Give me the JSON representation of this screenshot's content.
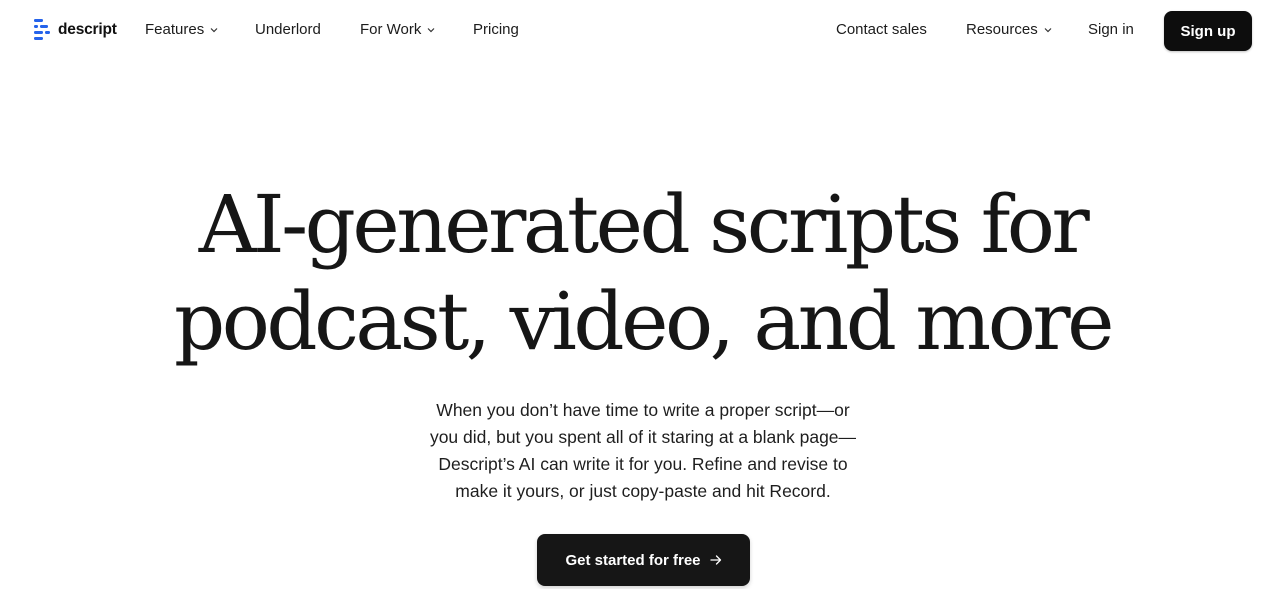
{
  "brand": {
    "name": "descript",
    "logo_icon": "descript-logo-icon",
    "accent_color": "#2563eb"
  },
  "nav": {
    "left": [
      {
        "label": "Features",
        "dropdown": true
      },
      {
        "label": "Underlord",
        "dropdown": false
      },
      {
        "label": "For Work",
        "dropdown": true
      },
      {
        "label": "Pricing",
        "dropdown": false
      }
    ],
    "right": [
      {
        "label": "Contact sales",
        "dropdown": false
      },
      {
        "label": "Resources",
        "dropdown": true
      },
      {
        "label": "Sign in",
        "dropdown": false
      }
    ],
    "signup_label": "Sign up",
    "dropdown_icon": "chevron-down-icon"
  },
  "hero": {
    "headline_lines": [
      "AI-generated scripts for",
      "podcast, video, and more"
    ],
    "subtext_lines": [
      "When you don’t have time to write a proper script—or",
      "you did, but you spent all of it staring at a blank page—",
      "Descript’s AI can write it for you. Refine and revise to",
      "make it yours, or just copy-paste and hit Record."
    ],
    "cta_label": "Get started for free",
    "cta_icon": "arrow-right-icon"
  }
}
